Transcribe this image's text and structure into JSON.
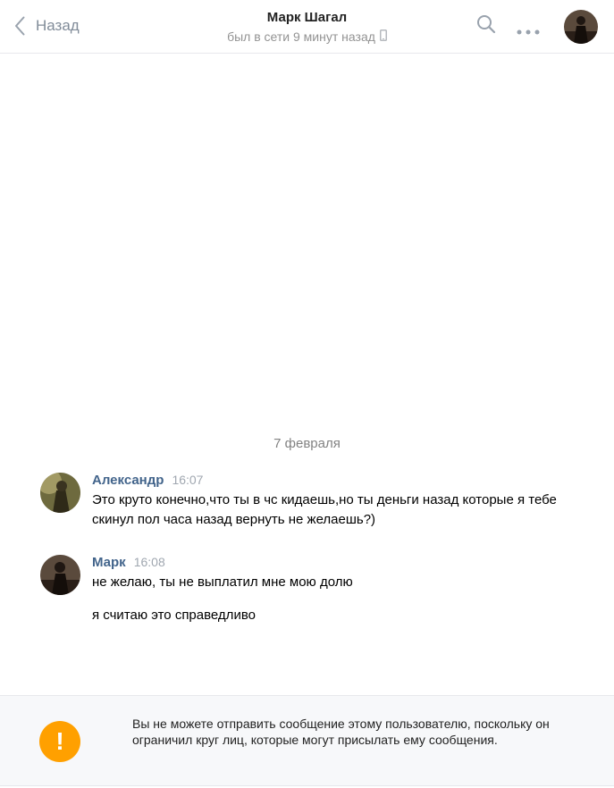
{
  "header": {
    "back_label": "Назад",
    "title": "Марк Шагал",
    "status": "был в сети 9 минут назад",
    "icons": {
      "back": "chevron-left-icon",
      "device": "mobile-phone-icon",
      "search": "search-icon",
      "more": "more-dots-icon"
    }
  },
  "chat": {
    "date_separator": "7 февраля",
    "messages": [
      {
        "author": "Александр",
        "time": "16:07",
        "texts": [
          "Это круто конечно,что ты в чс кидаешь,но ты деньги назад которые я тебе скинул пол часа назад вернуть не желаешь?)"
        ]
      },
      {
        "author": "Марк",
        "time": "16:08",
        "texts": [
          "не желаю, ты не выплатил мне мою долю",
          "я считаю это справедливо"
        ]
      }
    ]
  },
  "notice": {
    "icon_text": "!",
    "text": "Вы не можете отправить сообщение этому пользователю, поскольку он ограничил круг лиц, которые могут присылать ему сообщения.",
    "accent": "#ffa000"
  },
  "colors": {
    "author_link": "#42648b",
    "muted": "#818c99",
    "divider": "#e7e8ec"
  }
}
